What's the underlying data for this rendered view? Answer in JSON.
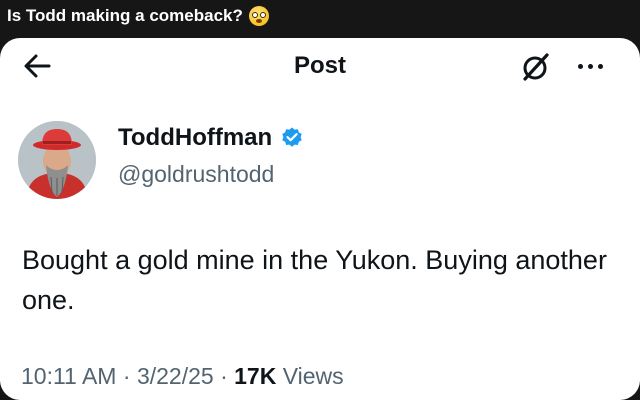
{
  "caption": {
    "text": "Is Todd making a comeback?",
    "emoji": "flushed-face"
  },
  "header": {
    "title": "Post",
    "back_icon": "arrow-left",
    "grok_icon": "grok-slash-circle",
    "more_icon": "ellipsis"
  },
  "author": {
    "display_name": "ToddHoffman",
    "handle": "@goldrushtodd",
    "verified": true,
    "verified_color": "#1d9bf0"
  },
  "tweet": {
    "text": "Bought a gold mine in the Yukon. Buying another one."
  },
  "meta": {
    "time": "10:11 AM",
    "sep1": "·",
    "date": "3/22/25",
    "sep2": "·",
    "views_count": "17K",
    "views_label": "Views"
  },
  "colors": {
    "text": "#0f1419",
    "secondary": "#536471",
    "background": "#161616",
    "card": "#ffffff"
  }
}
